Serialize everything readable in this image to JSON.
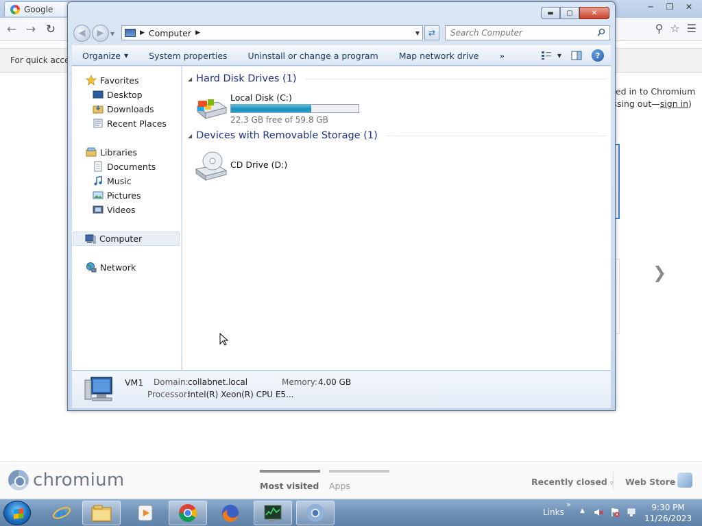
{
  "chrome": {
    "tab_title": "Google",
    "infobar_text": "For quick access",
    "signin_line1": "ned in to Chromium",
    "signin_line2_prefix": "issing out—",
    "signin_link": "sign in",
    "signin_line2_suffix": ")",
    "next_arrow": "❯",
    "brand": "chromium",
    "footer_tabs": [
      "Most visited",
      "Apps"
    ],
    "recently_closed": "Recently closed",
    "web_store": "Web Store"
  },
  "explorer": {
    "location": "Computer",
    "search_placeholder": "Search Computer",
    "commands": [
      "Organize",
      "System properties",
      "Uninstall or change a program",
      "Map network drive"
    ],
    "more_commands": "»",
    "nav": {
      "favorites": "Favorites",
      "favorites_items": [
        "Desktop",
        "Downloads",
        "Recent Places"
      ],
      "libraries": "Libraries",
      "libraries_items": [
        "Documents",
        "Music",
        "Pictures",
        "Videos"
      ],
      "computer": "Computer",
      "network": "Network"
    },
    "groups": {
      "hdd_title": "Hard Disk Drives (1)",
      "removable_title": "Devices with Removable Storage (1)"
    },
    "drives": {
      "c_name": "Local Disk (C:)",
      "c_free": "22.3 GB free of 59.8 GB",
      "c_used_fraction": 0.627,
      "d_name": "CD Drive (D:)"
    },
    "details": {
      "name": "VM1",
      "domain_label": "Domain:",
      "domain_value": "collabnet.local",
      "memory_label": "Memory:",
      "memory_value": "4.00 GB",
      "processor_label": "Processor:",
      "processor_value": "Intel(R) Xeon(R) CPU E5..."
    }
  },
  "taskbar": {
    "links": "Links",
    "links_chevron": "»",
    "time": "9:30 PM",
    "date": "11/26/2023"
  }
}
